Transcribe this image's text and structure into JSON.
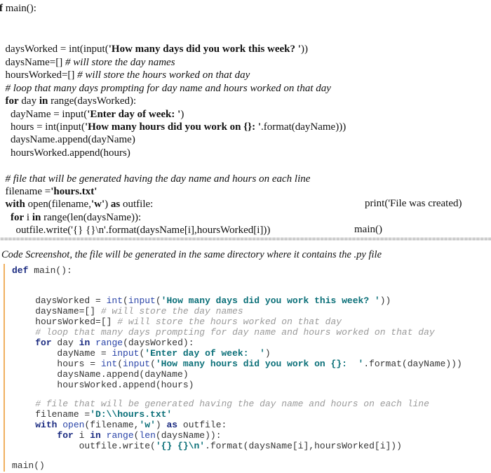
{
  "top_code": [
    [
      {
        "t": "def",
        "s": "b"
      },
      {
        "t": " main():"
      }
    ],
    [],
    [
      {
        "t": "  daysWorked = int(input("
      },
      {
        "t": "'How many days did you work this week? '",
        "s": "b"
      },
      {
        "t": "))"
      }
    ],
    [
      {
        "t": "  daysName=[] "
      },
      {
        "t": "# will store the day names",
        "s": "i"
      }
    ],
    [
      {
        "t": "  hoursWorked=[] "
      },
      {
        "t": "# will store the hours worked on that day",
        "s": "i"
      }
    ],
    [
      {
        "t": "  "
      },
      {
        "t": "# loop that many days prompting for day name and hours worked on that day",
        "s": "i"
      }
    ],
    [
      {
        "t": "  "
      },
      {
        "t": "for",
        "s": "b"
      },
      {
        "t": " day "
      },
      {
        "t": "in",
        "s": "b"
      },
      {
        "t": " range(daysWorked):"
      }
    ],
    [
      {
        "t": "    dayName = input("
      },
      {
        "t": "'Enter day of week: '",
        "s": "b"
      },
      {
        "t": ")"
      }
    ],
    [
      {
        "t": "    hours = int(input("
      },
      {
        "t": "'How many hours did you work on {}: '",
        "s": "b"
      },
      {
        "t": ".format(dayName)))"
      }
    ],
    [
      {
        "t": "    daysName.append(dayName)"
      }
    ],
    [
      {
        "t": "    hoursWorked.append(hours)"
      }
    ],
    [],
    [
      {
        "t": "  "
      },
      {
        "t": "# file that will be generated having the day name and hours on each line",
        "s": "i"
      }
    ],
    [
      {
        "t": "  filename ="
      },
      {
        "t": "'hours.txt'",
        "s": "b"
      }
    ],
    [
      {
        "t": "  "
      },
      {
        "t": "with",
        "s": "b"
      },
      {
        "t": " open(filename,"
      },
      {
        "t": "'w'",
        "s": "b"
      },
      {
        "t": ") "
      },
      {
        "t": "as",
        "s": "b"
      },
      {
        "t": " outfile:"
      }
    ],
    [
      {
        "t": "    "
      },
      {
        "t": "for",
        "s": "b"
      },
      {
        "t": " i "
      },
      {
        "t": "in",
        "s": "b"
      },
      {
        "t": " range(len(daysName)):"
      }
    ],
    [
      {
        "t": "      outfile.write('{} {}\\n'.format(daysName[i],hoursWorked[i]))"
      }
    ]
  ],
  "side_print": "print('File was created)",
  "side_main": "main()",
  "separator": "==================================================================================================================================",
  "caption": "Code Screenshot, the file will be generated in the same directory where it contains the .py file",
  "screenshot_code": [
    [
      {
        "t": "def",
        "s": "kw"
      },
      {
        "t": " main():"
      }
    ],
    [],
    [],
    [
      {
        "t": "    daysWorked = "
      },
      {
        "t": "int",
        "s": "fn"
      },
      {
        "t": "("
      },
      {
        "t": "input",
        "s": "fn"
      },
      {
        "t": "("
      },
      {
        "t": "'How many days did you work this week? '",
        "s": "str"
      },
      {
        "t": "))"
      }
    ],
    [
      {
        "t": "    daysName=[] "
      },
      {
        "t": "# will store the day names",
        "s": "cm"
      }
    ],
    [
      {
        "t": "    hoursWorked=[] "
      },
      {
        "t": "# will store the hours worked on that day",
        "s": "cm"
      }
    ],
    [
      {
        "t": "    "
      },
      {
        "t": "# loop that many days prompting for day name and hours worked on that day",
        "s": "cm"
      }
    ],
    [
      {
        "t": "    "
      },
      {
        "t": "for",
        "s": "kw"
      },
      {
        "t": " day "
      },
      {
        "t": "in",
        "s": "kw"
      },
      {
        "t": " "
      },
      {
        "t": "range",
        "s": "fn"
      },
      {
        "t": "(daysWorked):"
      }
    ],
    [
      {
        "t": "        dayName = "
      },
      {
        "t": "input",
        "s": "fn"
      },
      {
        "t": "("
      },
      {
        "t": "'Enter day of week:  '",
        "s": "str"
      },
      {
        "t": ")"
      }
    ],
    [
      {
        "t": "        hours = "
      },
      {
        "t": "int",
        "s": "fn"
      },
      {
        "t": "("
      },
      {
        "t": "input",
        "s": "fn"
      },
      {
        "t": "("
      },
      {
        "t": "'How many hours did you work on {}:  '",
        "s": "str"
      },
      {
        "t": ".format(dayName)))"
      }
    ],
    [
      {
        "t": "        daysName.append(dayName)"
      }
    ],
    [
      {
        "t": "        hoursWorked.append(hours)"
      }
    ],
    [],
    [
      {
        "t": "    "
      },
      {
        "t": "# file that will be generated having the day name and hours on each line",
        "s": "cm"
      }
    ],
    [
      {
        "t": "    filename ="
      },
      {
        "t": "'D:\\\\hours.txt'",
        "s": "str"
      }
    ],
    [
      {
        "t": "    "
      },
      {
        "t": "with",
        "s": "kw"
      },
      {
        "t": " "
      },
      {
        "t": "open",
        "s": "fn"
      },
      {
        "t": "(filename,"
      },
      {
        "t": "'w'",
        "s": "str"
      },
      {
        "t": ") "
      },
      {
        "t": "as",
        "s": "kw"
      },
      {
        "t": " outfile:"
      }
    ],
    [
      {
        "t": "        "
      },
      {
        "t": "for",
        "s": "kw"
      },
      {
        "t": " i "
      },
      {
        "t": "in",
        "s": "kw"
      },
      {
        "t": " "
      },
      {
        "t": "range",
        "s": "fn"
      },
      {
        "t": "("
      },
      {
        "t": "len",
        "s": "fn"
      },
      {
        "t": "(daysName)):"
      }
    ],
    [
      {
        "t": "            outfile.write("
      },
      {
        "t": "'{} {}\\n'",
        "s": "str"
      },
      {
        "t": ".format(daysName[i],hoursWorked[i]))"
      }
    ],
    [],
    [
      {
        "t": "main()"
      }
    ]
  ]
}
